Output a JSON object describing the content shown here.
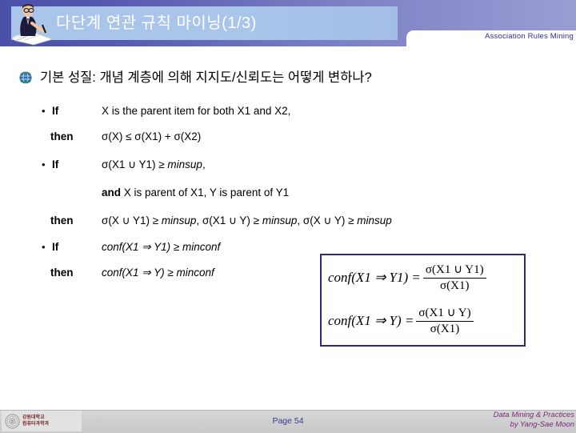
{
  "header": {
    "title": "다단계 연관 규칙 마이닝(1/3)",
    "subtitle": "Association Rules Mining",
    "person_icon": "person-writing-icon",
    "band_color": "#a9c6ea",
    "bar_color": "#5558ae"
  },
  "main_bullet": {
    "icon": "globe-icon",
    "text": "기본 성질: 개념 계층에 의해 지지도/신뢰도는 어떻게 변하나?"
  },
  "blocks": [
    {
      "if_label": "If",
      "if_text": "X is the parent item for both X1 and X2,",
      "then_label": "then",
      "then_text": "σ(X) ≤ σ(X1) + σ(X2)"
    },
    {
      "if_label": "If",
      "if_text_plain": "σ(X1 ∪ Y1) ≥ ",
      "if_text_italic": "minsup",
      "if_text_tail": ",",
      "and_label": "and",
      "and_text": " X is parent of X1, Y is parent of Y1",
      "then_label": "then",
      "then_parts": [
        {
          "plain": "σ(X ∪ Y1) ≥ ",
          "italic": "minsup",
          "tail": ", "
        },
        {
          "plain": "σ(X1 ∪ Y) ≥ ",
          "italic": "minsup",
          "tail": ", "
        },
        {
          "plain": "σ(X ∪ Y) ≥ ",
          "italic": "minsup",
          "tail": ""
        }
      ]
    },
    {
      "if_label": "If",
      "if_text": "conf(X1 ⇒ Y1) ≥ minconf",
      "then_label": "then",
      "then_text": "conf(X1 ⇒ Y) ≥ minconf"
    }
  ],
  "formula_box": {
    "border_color": "#2b2b7a",
    "equations": [
      {
        "lhs": "conf(X1 ⇒ Y1) =",
        "numerator": "σ(X1 ∪ Y1)",
        "denominator": "σ(X1)"
      },
      {
        "lhs": "conf(X1 ⇒ Y) =",
        "numerator": "σ(X1 ∪ Y)",
        "denominator": "σ(X1)"
      }
    ]
  },
  "footer": {
    "logo_icon": "university-seal-icon",
    "logo_line1": "강원대학교",
    "logo_line2": "컴퓨터과학과",
    "page": "Page 54",
    "credit_line1": "Data Mining & Practices",
    "credit_line2": "by Yang-Sae Moon",
    "credit_color": "#7a2a7a"
  }
}
